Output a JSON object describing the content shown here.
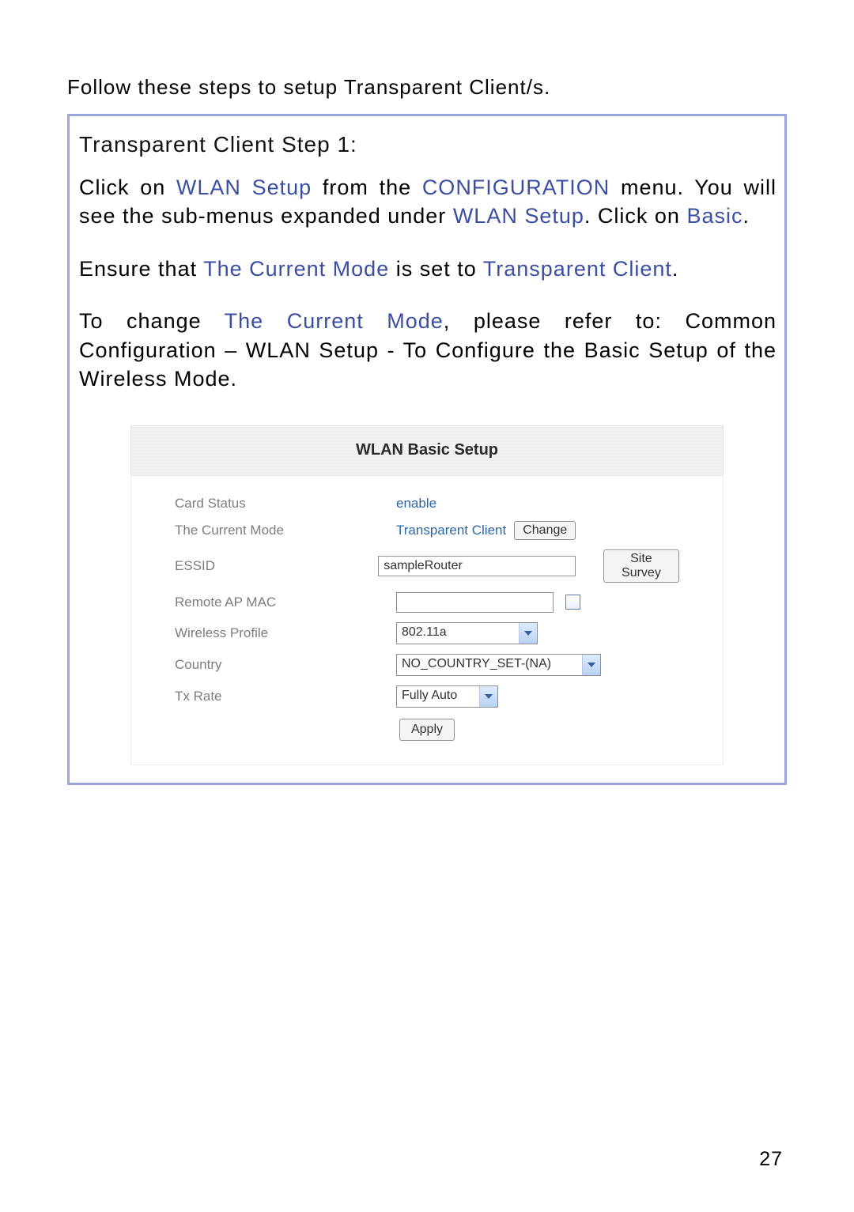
{
  "intro": "Follow these steps to setup Transparent Client/s.",
  "step": {
    "title": "Transparent Client Step 1:",
    "p1": {
      "t1": "Click on ",
      "k1": "WLAN Setup",
      "t2": " from the ",
      "k2": "CONFIGURATION",
      "t3": " menu. You will see the sub-menus expanded under ",
      "k3": "WLAN Setup",
      "t4": ". Click on ",
      "k4": "Basic",
      "t5": "."
    },
    "p2": {
      "t1": "Ensure that ",
      "k1": "The Current Mode",
      "t2": " is set to ",
      "k2": "Transparent Client",
      "t3": "."
    },
    "p3": {
      "t1": "To change ",
      "k1": "The Current Mode",
      "t2": ", please refer to: Common Configuration – WLAN Setup - To Configure the Basic Setup of the Wireless Mode."
    }
  },
  "panel": {
    "title": "WLAN Basic Setup",
    "labels": {
      "card_status": "Card Status",
      "current_mode": "The Current Mode",
      "essid": "ESSID",
      "remote_ap_mac": "Remote AP MAC",
      "wireless_profile": "Wireless Profile",
      "country": "Country",
      "tx_rate": "Tx Rate"
    },
    "values": {
      "card_status": "enable",
      "current_mode": "Transparent Client",
      "essid": "sampleRouter",
      "remote_ap_mac": "",
      "wireless_profile": "802.11a",
      "country": "NO_COUNTRY_SET-(NA)",
      "tx_rate": "Fully Auto"
    },
    "buttons": {
      "change": "Change",
      "site_survey": "Site Survey",
      "apply": "Apply"
    }
  },
  "page_number": "27"
}
